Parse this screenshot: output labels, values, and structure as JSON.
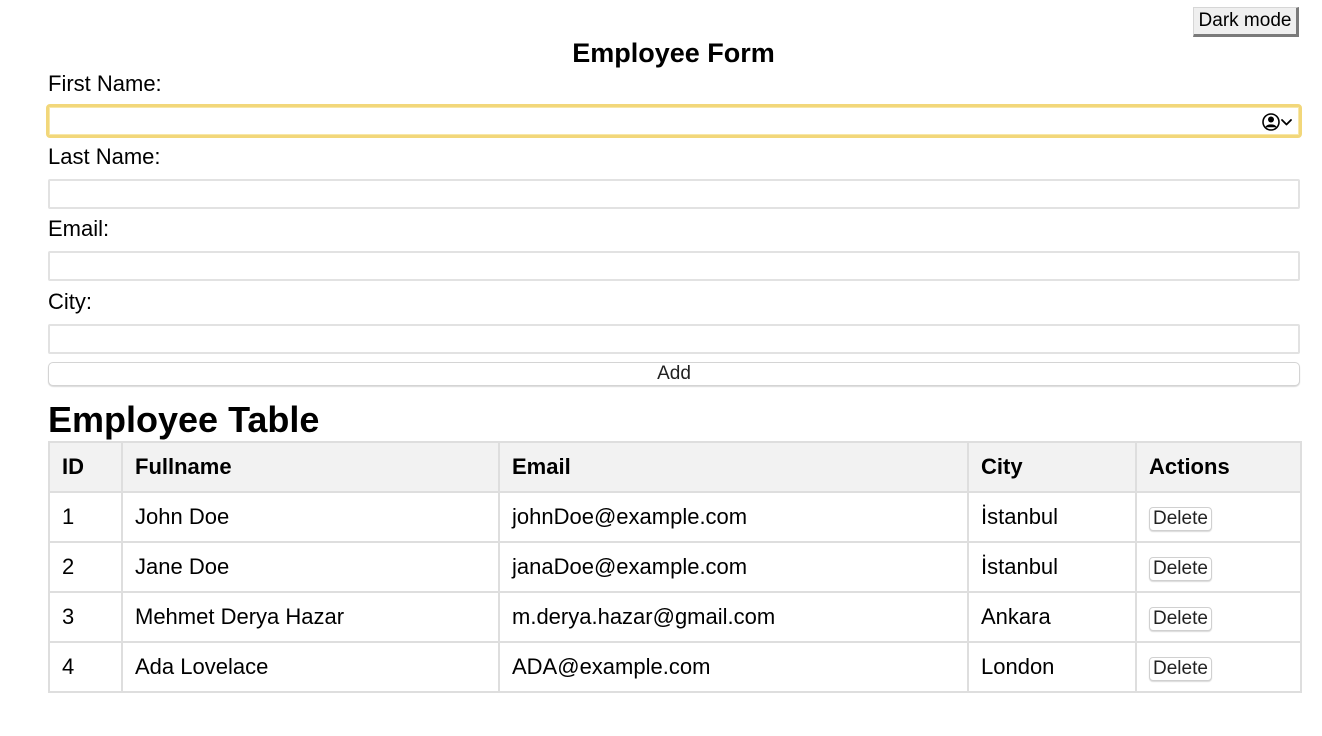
{
  "header": {
    "dark_mode_label": "Dark mode"
  },
  "form": {
    "title": "Employee Form",
    "first_name_label": "First Name:",
    "first_name_value": "",
    "last_name_label": "Last Name:",
    "last_name_value": "",
    "email_label": "Email:",
    "email_value": "",
    "city_label": "City:",
    "city_value": "",
    "add_label": "Add",
    "focused_field": "first_name",
    "autofill_icon": "contact-autofill-icon"
  },
  "table": {
    "title": "Employee Table",
    "columns": [
      "ID",
      "Fullname",
      "Email",
      "City",
      "Actions"
    ],
    "rows": [
      {
        "id": "1",
        "fullname": "John Doe",
        "email": "johnDoe@example.com",
        "city": "İstanbul",
        "action": "Delete"
      },
      {
        "id": "2",
        "fullname": "Jane Doe",
        "email": "janaDoe@example.com",
        "city": "İstanbul",
        "action": "Delete"
      },
      {
        "id": "3",
        "fullname": "Mehmet Derya Hazar",
        "email": "m.derya.hazar@gmail.com",
        "city": "Ankara",
        "action": "Delete"
      },
      {
        "id": "4",
        "fullname": "Ada Lovelace",
        "email": "ADA@example.com",
        "city": "London",
        "action": "Delete"
      }
    ]
  },
  "colors": {
    "focus_border": "#f2d77a",
    "header_bg": "#f2f2f2",
    "border": "#dedede"
  }
}
